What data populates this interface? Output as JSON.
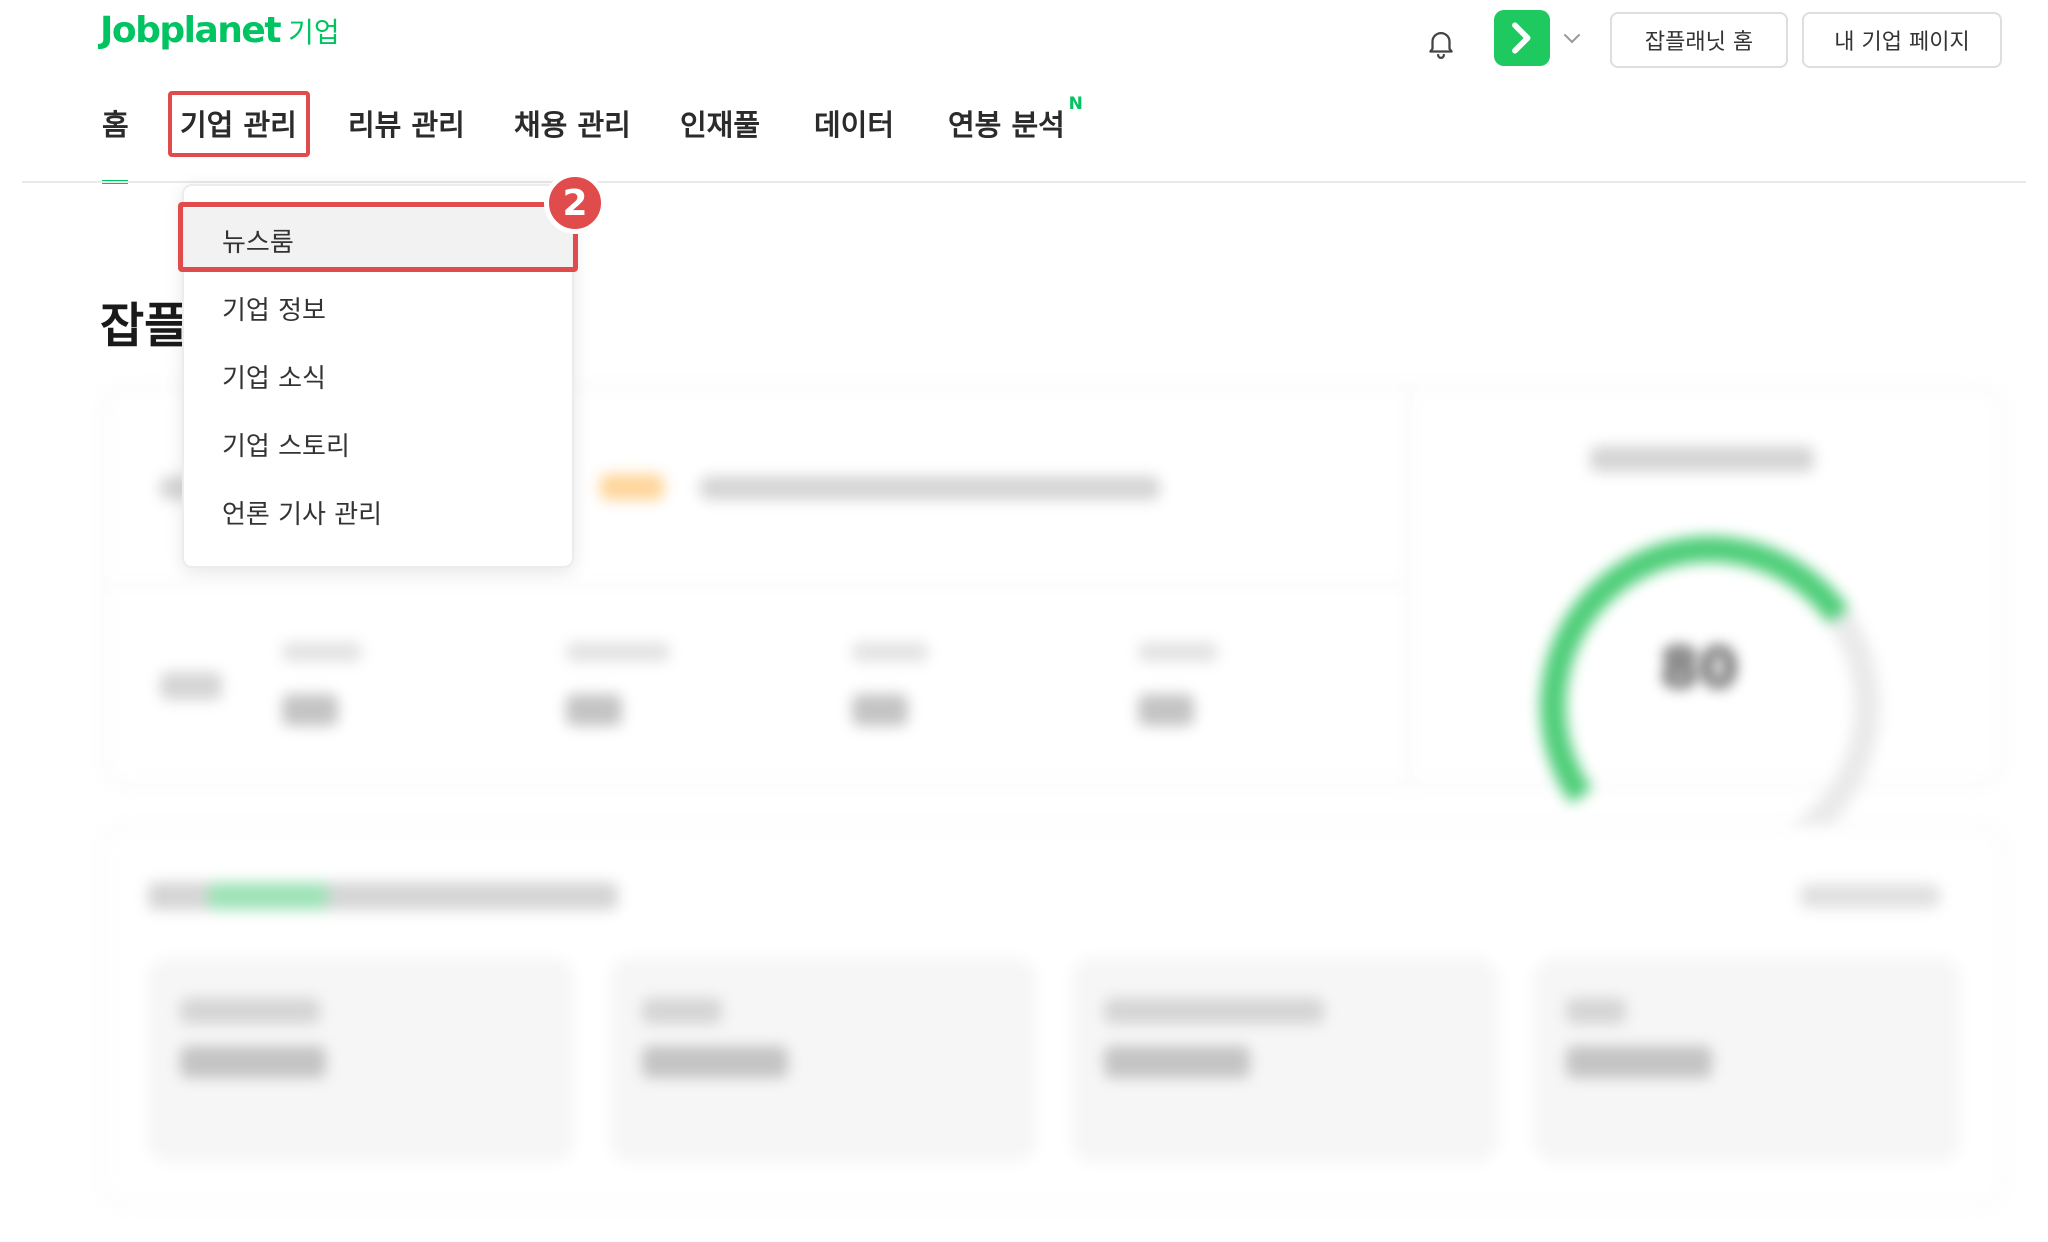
{
  "header": {
    "logo_word": "Jobplanet",
    "logo_sub": "기업",
    "jobplanet_home_btn": "잡플래닛 홈",
    "my_company_btn": "내 기업 페이지"
  },
  "nav": {
    "items": [
      {
        "label": "홈"
      },
      {
        "label": "기업 관리"
      },
      {
        "label": "리뷰 관리"
      },
      {
        "label": "채용 관리"
      },
      {
        "label": "인재풀"
      },
      {
        "label": "데이터"
      },
      {
        "label": "연봉 분석",
        "badge": "N"
      }
    ]
  },
  "dropdown": {
    "items": [
      {
        "label": "뉴스룸"
      },
      {
        "label": "기업 정보"
      },
      {
        "label": "기업 소식"
      },
      {
        "label": "기업 스토리"
      },
      {
        "label": "언론 기사 관리"
      }
    ]
  },
  "annotation": {
    "step": "2",
    "color": "#e04b4b"
  },
  "main": {
    "title_partial": "잡플",
    "gauge_value": "80"
  },
  "colors": {
    "brand": "#00c362",
    "highlight": "#e04b4b"
  }
}
